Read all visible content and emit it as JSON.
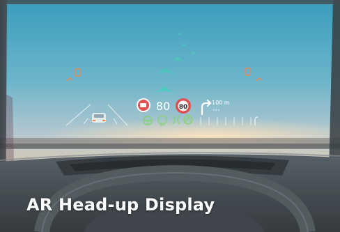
{
  "caption": "AR Head-up Display",
  "hud": {
    "speed_value": "80",
    "speed_limit": "80",
    "lane_badge": "80",
    "nav_distance": "100 m",
    "nav_turn": "right-turn-arrow-icon"
  },
  "colors": {
    "teal": "#3fc7b8",
    "orange": "#ff7a3a",
    "red_sign": "#e04444",
    "green_icon": "#7fd06a"
  }
}
